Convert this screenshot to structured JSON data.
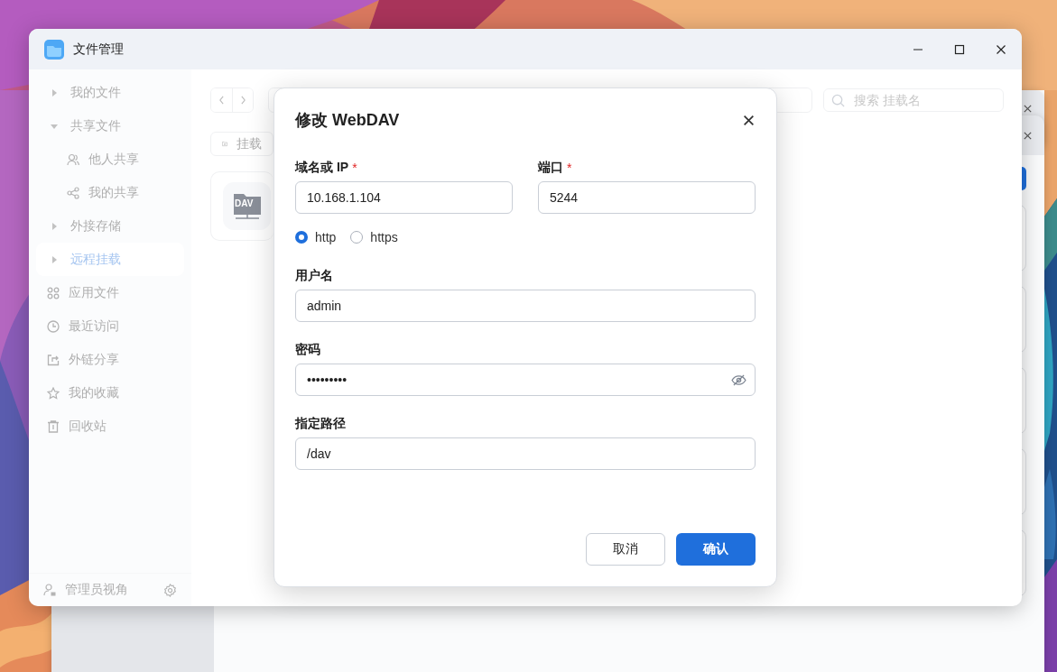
{
  "window": {
    "title": "文件管理"
  },
  "sidebar": {
    "items": [
      {
        "label": "我的文件",
        "kind": "group",
        "expanded": false,
        "selected": false
      },
      {
        "label": "共享文件",
        "kind": "group",
        "expanded": true,
        "selected": false,
        "children": [
          {
            "label": "他人共享",
            "selected": false
          },
          {
            "label": "我的共享",
            "selected": false
          }
        ]
      },
      {
        "label": "外接存储",
        "kind": "group",
        "expanded": false,
        "selected": false
      },
      {
        "label": "远程挂载",
        "kind": "group",
        "expanded": false,
        "selected": true
      },
      {
        "label": "应用文件",
        "kind": "link",
        "selected": false
      },
      {
        "label": "最近访问",
        "kind": "link",
        "selected": false
      },
      {
        "label": "外链分享",
        "kind": "link",
        "selected": false
      },
      {
        "label": "我的收藏",
        "kind": "link",
        "selected": false
      },
      {
        "label": "回收站",
        "kind": "link",
        "selected": false
      }
    ],
    "footer": {
      "label": "管理员视角"
    }
  },
  "toolbar": {
    "search": {
      "placeholder": "搜索 挂载名"
    },
    "mount_button": {
      "label": "挂载"
    }
  },
  "mounts": [
    {
      "icon_label": "DAV"
    }
  ],
  "dialog": {
    "title": "修改 WebDAV",
    "host_row": [
      {
        "label": "域名或 IP",
        "mark": "*",
        "value": "10.168.1.104"
      },
      {
        "label": "端口",
        "mark": "*",
        "value": "5244"
      }
    ],
    "protocol": [
      {
        "label": "http",
        "selected": true
      },
      {
        "label": "https",
        "selected": false
      }
    ],
    "fields": [
      {
        "label": "用户名",
        "kind": "text",
        "value": "admin"
      },
      {
        "label": "密码",
        "kind": "password",
        "value": "•••••••••",
        "visible": false
      },
      {
        "label": "指定路径",
        "kind": "text",
        "value": "/dav"
      }
    ],
    "buttons": [
      {
        "label": "取消",
        "kind": "secondary"
      },
      {
        "label": "确认",
        "kind": "primary"
      }
    ]
  }
}
